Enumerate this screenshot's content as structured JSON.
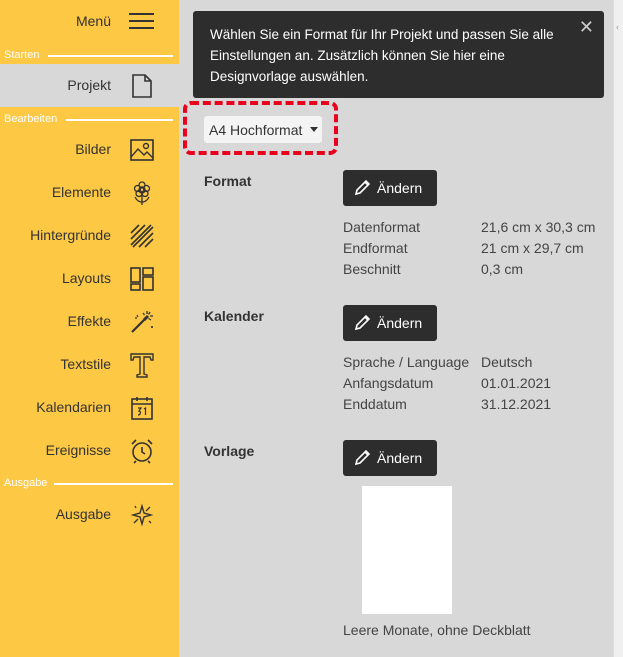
{
  "sidebar": {
    "menu_label": "Menü",
    "sections": {
      "starten": "Starten",
      "bearbeiten": "Bearbeiten",
      "ausgabe": "Ausgabe"
    },
    "items": [
      {
        "label": "Projekt",
        "icon": "document-icon"
      },
      {
        "label": "Bilder",
        "icon": "image-icon"
      },
      {
        "label": "Elemente",
        "icon": "flower-icon"
      },
      {
        "label": "Hintergründe",
        "icon": "hatch-pattern-icon"
      },
      {
        "label": "Layouts",
        "icon": "layout-grid-icon"
      },
      {
        "label": "Effekte",
        "icon": "magic-wand-icon"
      },
      {
        "label": "Textstile",
        "icon": "text-t-icon"
      },
      {
        "label": "Kalendarien",
        "icon": "calendar-icon"
      },
      {
        "label": "Ereignisse",
        "icon": "alarm-clock-icon"
      },
      {
        "label": "Ausgabe",
        "icon": "sparkle-output-icon"
      }
    ],
    "active_item": "Projekt",
    "accent_color": "#fdc843"
  },
  "tooltip": {
    "text": "Wählen Sie ein Format für Ihr Projekt und passen Sie alle Einstellungen an. Zusätzlich können Sie hier eine Designvorlage auswählen.",
    "close_symbol": "✕"
  },
  "format_select": {
    "value": "A4 Hochformat"
  },
  "sections": {
    "format": {
      "title": "Format",
      "button": "Ändern",
      "rows": [
        {
          "key": "Datenformat",
          "value": "21,6 cm x 30,3 cm"
        },
        {
          "key": "Endformat",
          "value": "21 cm x 29,7 cm"
        },
        {
          "key": "Beschnitt",
          "value": "0,3 cm"
        }
      ]
    },
    "kalender": {
      "title": "Kalender",
      "button": "Ändern",
      "rows": [
        {
          "key": "Sprache / Language",
          "value": "Deutsch"
        },
        {
          "key": "Anfangsdatum",
          "value": "01.01.2021"
        },
        {
          "key": "Enddatum",
          "value": "31.12.2021"
        }
      ]
    },
    "vorlage": {
      "title": "Vorlage",
      "button": "Ändern",
      "caption": "Leere Monate, ohne Deckblatt"
    }
  },
  "colors": {
    "highlight": "#e8001c",
    "dark_button": "#2d2d2d",
    "panel_bg": "#d8d8d8"
  }
}
